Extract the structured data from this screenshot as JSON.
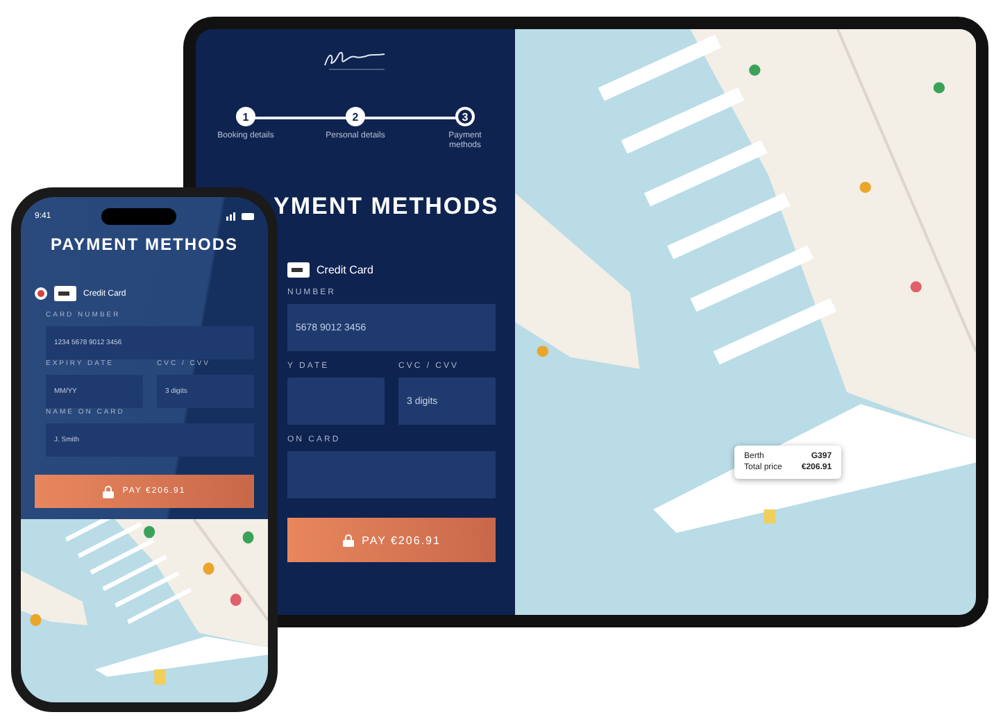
{
  "tablet": {
    "steps": [
      {
        "number": "1",
        "label": "Booking details",
        "selected": false
      },
      {
        "number": "2",
        "label": "Personal details",
        "selected": false
      },
      {
        "number": "3",
        "label": "Payment methods",
        "selected": true
      }
    ],
    "title": "YMENT METHODS",
    "payment_option": {
      "label": "Credit Card"
    },
    "field_rows": [
      [
        {
          "label": "NUMBER",
          "value": "5678 9012 3456"
        }
      ],
      [
        {
          "label": "Y DATE"
        },
        {
          "label": "CVC / CVV",
          "placeholder": "3 digits"
        }
      ],
      [
        {
          "label": "ON CARD"
        }
      ]
    ],
    "pay_button": "PAY €206.91",
    "popup": [
      {
        "label": "Berth",
        "value": "G397"
      },
      {
        "label": "Total price",
        "value": "€206.91"
      }
    ]
  },
  "phone": {
    "time": "9:41",
    "title": "PAYMENT METHODS",
    "payment_option": {
      "label": "Credit Card",
      "selected": true
    },
    "field_rows": [
      [
        {
          "label": "CARD NUMBER",
          "value": "1234 5678 9012 3456"
        }
      ],
      [
        {
          "label": "EXPIRY DATE",
          "value": "MM/YY"
        },
        {
          "label": "CVC / CVV",
          "placeholder": "3 digits"
        }
      ],
      [
        {
          "label": "NAME ON CARD",
          "value": "J. Smith"
        }
      ]
    ],
    "pay_button": "PAY €206.91"
  }
}
